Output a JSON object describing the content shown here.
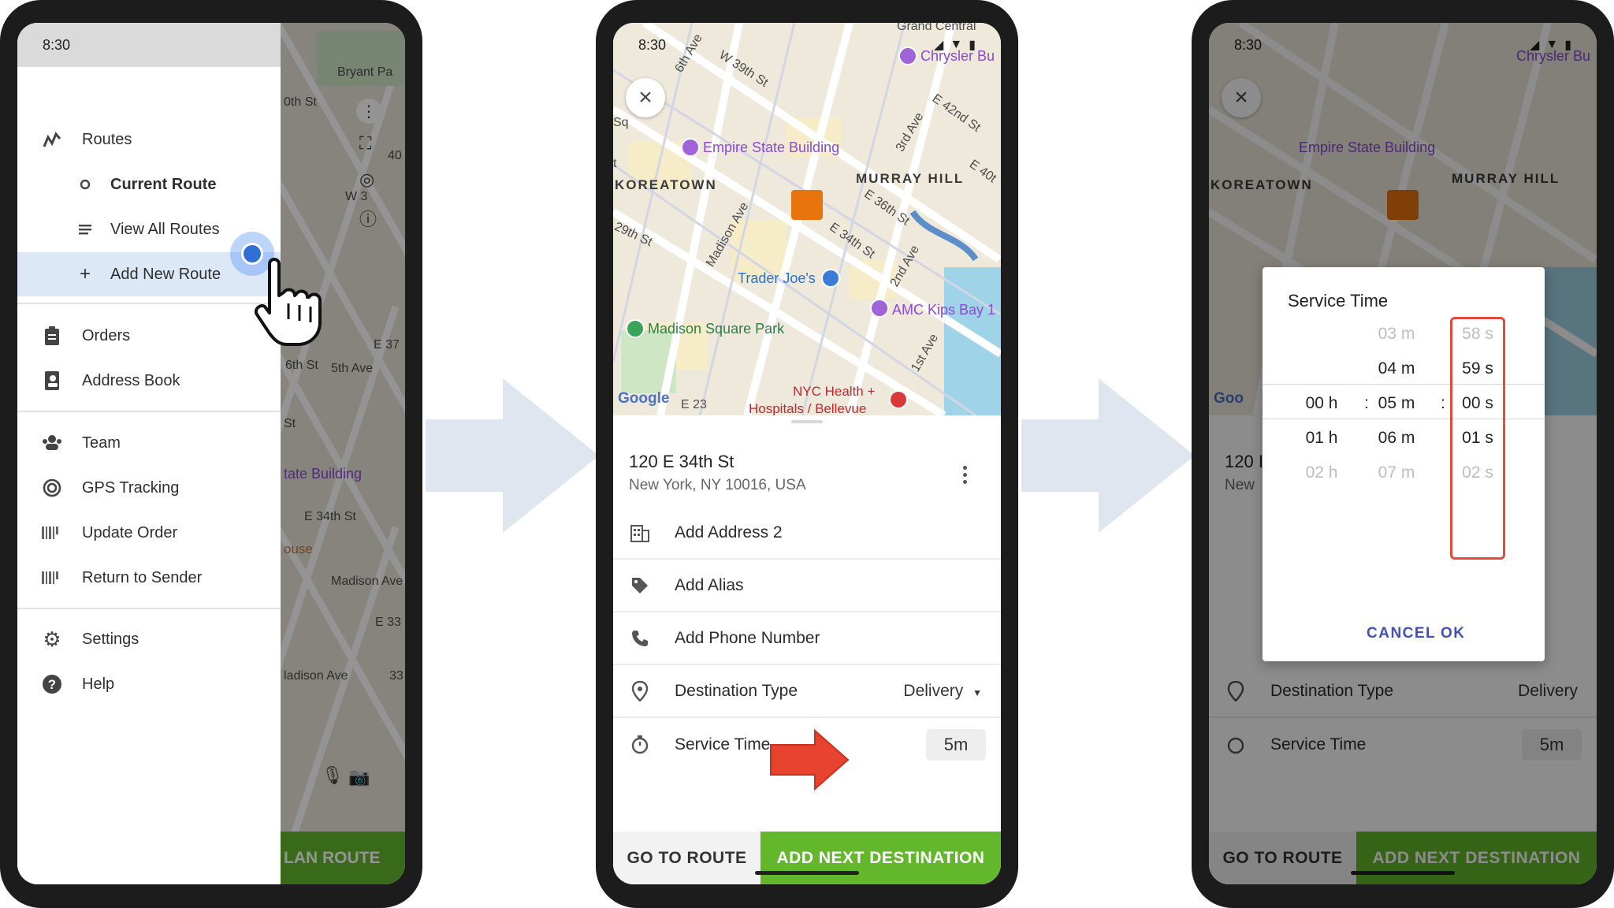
{
  "status": {
    "time": "8:30"
  },
  "colors": {
    "accent_green": "#62b72b",
    "active_menu": "#dde8f7",
    "arrow_red": "#e8432e",
    "dialog_button": "#3f51b5",
    "highlight": "#e74a3b"
  },
  "phone1": {
    "menu": [
      {
        "label": "Routes",
        "icon": "routes-icon"
      },
      {
        "label": "Current Route",
        "icon": "circle-icon"
      },
      {
        "label": "View All Routes",
        "icon": "list-icon"
      },
      {
        "label": "Add New Route",
        "icon": "plus-icon"
      },
      {
        "label": "Orders",
        "icon": "clipboard-icon"
      },
      {
        "label": "Address Book",
        "icon": "address-book-icon"
      },
      {
        "label": "Team",
        "icon": "team-icon"
      },
      {
        "label": "GPS Tracking",
        "icon": "gps-icon"
      },
      {
        "label": "Update Order",
        "icon": "barcode-icon"
      },
      {
        "label": "Return to Sender",
        "icon": "barcode-icon"
      },
      {
        "label": "Settings",
        "icon": "gear-icon"
      },
      {
        "label": "Help",
        "icon": "help-icon"
      }
    ],
    "map_labels": {
      "park": "Bryant Pa",
      "st1": "0th St",
      "st2": "W 3",
      "st3": "40",
      "st4": "E 37",
      "st5": "6th St",
      "st6": "5th Ave",
      "st7": "St",
      "building": "tate Building",
      "st8": "E 34th St",
      "house": "ouse",
      "ave": "Madison Ave",
      "st9": "E 33",
      "ave2": "ladison Ave",
      "num": "33",
      "plan_route": "LAN ROUTE"
    }
  },
  "phone2": {
    "map_labels": {
      "central": "Grand Central",
      "chrysler": "Chrysler Bu",
      "ave6": "6th Ave",
      "st39": "W 39th St",
      "sq": "Sq",
      "esb": "Empire State Building",
      "ave3": "3rd Ave",
      "st42": "E 42nd St",
      "t": "t",
      "koreatown": "KOREATOWN",
      "murray": "MURRAY HILL",
      "st40": "E 40t",
      "madison": "Madison Ave",
      "st36": "E 36th St",
      "st29": "29th St",
      "st34": "E 34th St",
      "ave2": "2nd Ave",
      "traderjoes": "Trader Joe's",
      "amc": "AMC Kips Bay 1",
      "msp": "Madison Square Park",
      "ave1": "1st Ave",
      "nych": "NYC Health +",
      "hosp": "Hospitals / Bellevue",
      "google": "Google",
      "e23": "E 23"
    },
    "address_title": "120 E 34th St",
    "address_sub": "New York, NY 10016, USA",
    "rows": {
      "address2": "Add Address 2",
      "alias": "Add Alias",
      "phone": "Add Phone Number",
      "dest_type": "Destination Type",
      "dest_value": "Delivery",
      "service_time": "Service Time",
      "service_value": "5m"
    },
    "buttons": {
      "go": "GO TO ROUTE",
      "next": "ADD NEXT DESTINATION"
    }
  },
  "phone3": {
    "map_labels": {
      "chrysler": "Chrysler Bu",
      "esb": "Empire State Building",
      "koreatown": "KOREATOWN",
      "murray": "MURRAY HILL",
      "google": "Goo"
    },
    "bg": {
      "title": "120 I",
      "sub": "New",
      "dest_type": "Destination Type",
      "dest_value": "Delivery",
      "service_time": "Service Time",
      "service_value": "5m",
      "go": "GO TO ROUTE",
      "next": "ADD NEXT DESTINATION"
    },
    "dialog": {
      "title": "Service Time",
      "minutes_above": [
        "03 m",
        "04 m"
      ],
      "seconds_above": [
        "58 s",
        "59 s"
      ],
      "hours": [
        "00 h",
        "01 h",
        "02 h"
      ],
      "minutes": [
        "05 m",
        "06 m",
        "07 m"
      ],
      "seconds": [
        "00 s",
        "01 s",
        "02 s"
      ],
      "colon": ":",
      "cancel": "CANCEL",
      "ok": "OK"
    }
  }
}
